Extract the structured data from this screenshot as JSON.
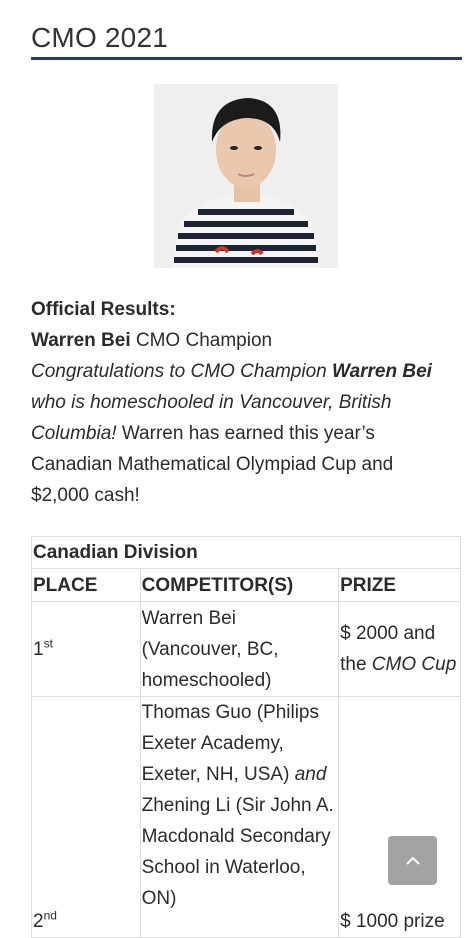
{
  "page": {
    "title": "CMO 2021"
  },
  "results": {
    "heading": "Official Results:",
    "champion_name": "Warren Bei",
    "champion_title": " CMO Champion",
    "congrats_prefix": "Congratulations to CMO Champion ",
    "congrats_name": "Warren Bei",
    "congrats_suffix": " who is homeschooled in Vancouver, British Columbia!",
    "earned_text": " Warren has earned this year’s Canadian Mathematical Olympiad Cup and $2,000 cash!"
  },
  "table": {
    "caption": "Canadian Division",
    "headers": {
      "place": "PLACE",
      "competitor": "COMPETITOR(S)",
      "prize": "PRIZE"
    },
    "rows": [
      {
        "place_num": "1",
        "place_sup": "st",
        "competitor": "Warren Bei (Vancouver, BC, homeschooled)",
        "prize_text": "$ 2000 and the ",
        "prize_em": "CMO Cup"
      },
      {
        "place_num": "2",
        "place_sup": "nd",
        "competitor_a": "Thomas Guo (Philips Exeter Academy, Exeter, NH, USA) ",
        "competitor_and": "and",
        "competitor_b": " Zhening Li (Sir John A. Macdonald Secondary School in Waterloo, ON)",
        "prize_text": "$ 1000 prize"
      }
    ]
  },
  "controls": {
    "scroll_top_icon": "chevron-up-icon"
  }
}
